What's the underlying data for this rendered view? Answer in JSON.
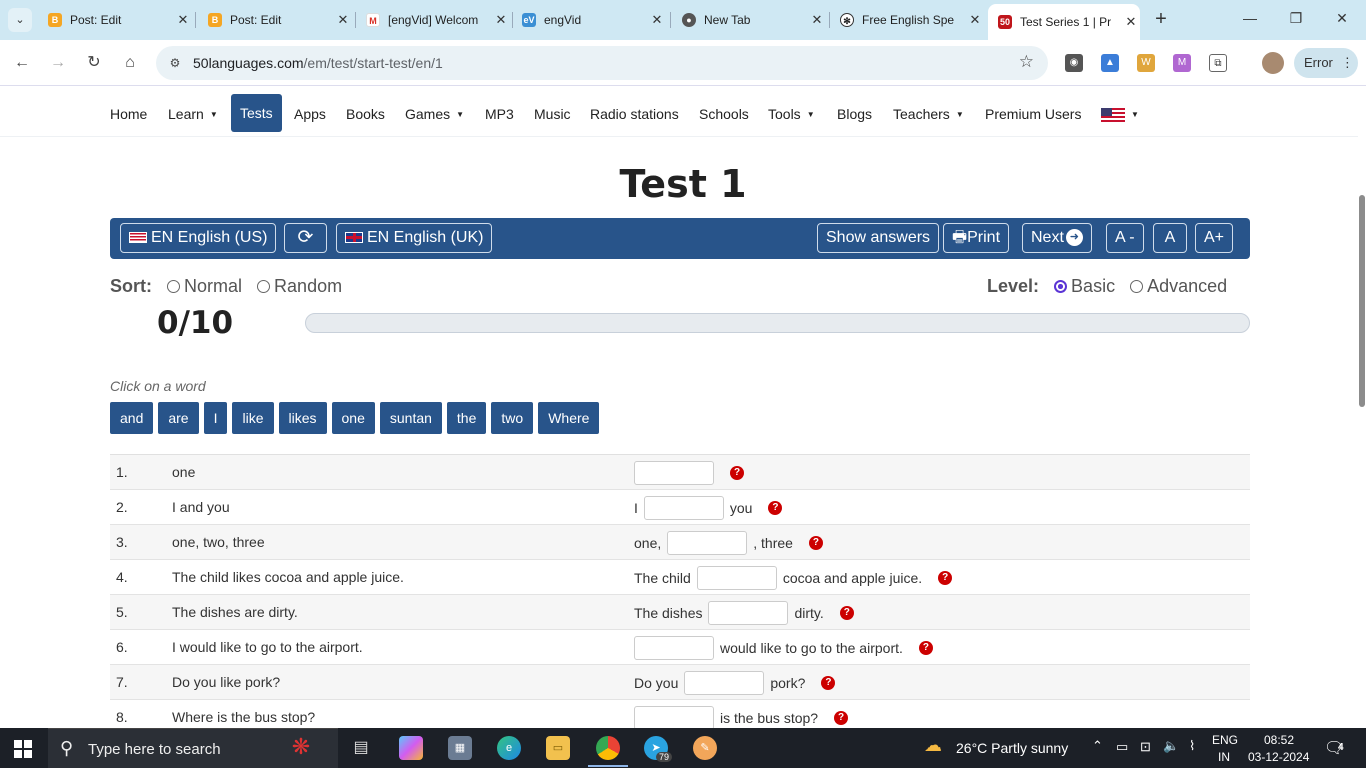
{
  "browser": {
    "tabs": [
      {
        "title": "Post: Edit",
        "favicon": "blogger-icon"
      },
      {
        "title": "Post: Edit",
        "favicon": "blogger-icon"
      },
      {
        "title": "[engVid] Welcom",
        "favicon": "gmail-icon"
      },
      {
        "title": "engVid",
        "favicon": "engvid-icon"
      },
      {
        "title": "New Tab",
        "favicon": "chrome-icon"
      },
      {
        "title": "Free English Spe",
        "favicon": "openai-icon"
      },
      {
        "title": "Test Series 1 | Pr",
        "favicon": "50languages-icon"
      }
    ],
    "url_domain": "50languages.com",
    "url_path": "/em/test/start-test/en/1",
    "error_label": "Error"
  },
  "nav": {
    "items": [
      "Home",
      "Learn",
      "Tests",
      "Apps",
      "Books",
      "Games",
      "MP3",
      "Music",
      "Radio stations",
      "Schools",
      "Tools",
      "Blogs",
      "Teachers",
      "Premium Users"
    ]
  },
  "page": {
    "title": "Test 1",
    "source_lang": "EN English (US)",
    "target_lang": "EN English (UK)",
    "show_answers": "Show answers",
    "print": "Print",
    "next": "Next",
    "font_smaller": "A -",
    "font_normal": "A",
    "font_larger": "A+",
    "sort_label": "Sort:",
    "sort_normal": "Normal",
    "sort_random": "Random",
    "level_label": "Level:",
    "level_basic": "Basic",
    "level_advanced": "Advanced",
    "score": "0/10",
    "progress": 0,
    "hint": "Click on a word",
    "words": [
      "and",
      "are",
      "I",
      "like",
      "likes",
      "one",
      "suntan",
      "the",
      "two",
      "Where"
    ]
  },
  "questions": [
    {
      "num": "1.",
      "source": "one",
      "before": "",
      "after": ""
    },
    {
      "num": "2.",
      "source": "I and you",
      "before": "I",
      "after": "you"
    },
    {
      "num": "3.",
      "source": "one, two, three",
      "before": "one,",
      "after": ", three"
    },
    {
      "num": "4.",
      "source": "The child likes cocoa and apple juice.",
      "before": "The child",
      "after": "cocoa and apple juice."
    },
    {
      "num": "5.",
      "source": "The dishes are dirty.",
      "before": "The dishes",
      "after": "dirty."
    },
    {
      "num": "6.",
      "source": "I would like to go to the airport.",
      "before": "",
      "after": "would like to go to the airport."
    },
    {
      "num": "7.",
      "source": "Do you like pork?",
      "before": "Do you",
      "after": "pork?"
    },
    {
      "num": "8.",
      "source": "Where is the bus stop?",
      "before": "",
      "after": "is the bus stop?"
    }
  ],
  "taskbar": {
    "search_placeholder": "Type here to search",
    "weather": "26°C  Partly sunny",
    "lang_top": "ENG",
    "lang_bottom": "IN",
    "time": "08:52",
    "date": "03-12-2024",
    "telegram_badge": "79",
    "notification_count": "4"
  },
  "colors": {
    "accent": "#28548a",
    "error_mark": "#cc0000",
    "radio_selected": "#5b35d5"
  }
}
